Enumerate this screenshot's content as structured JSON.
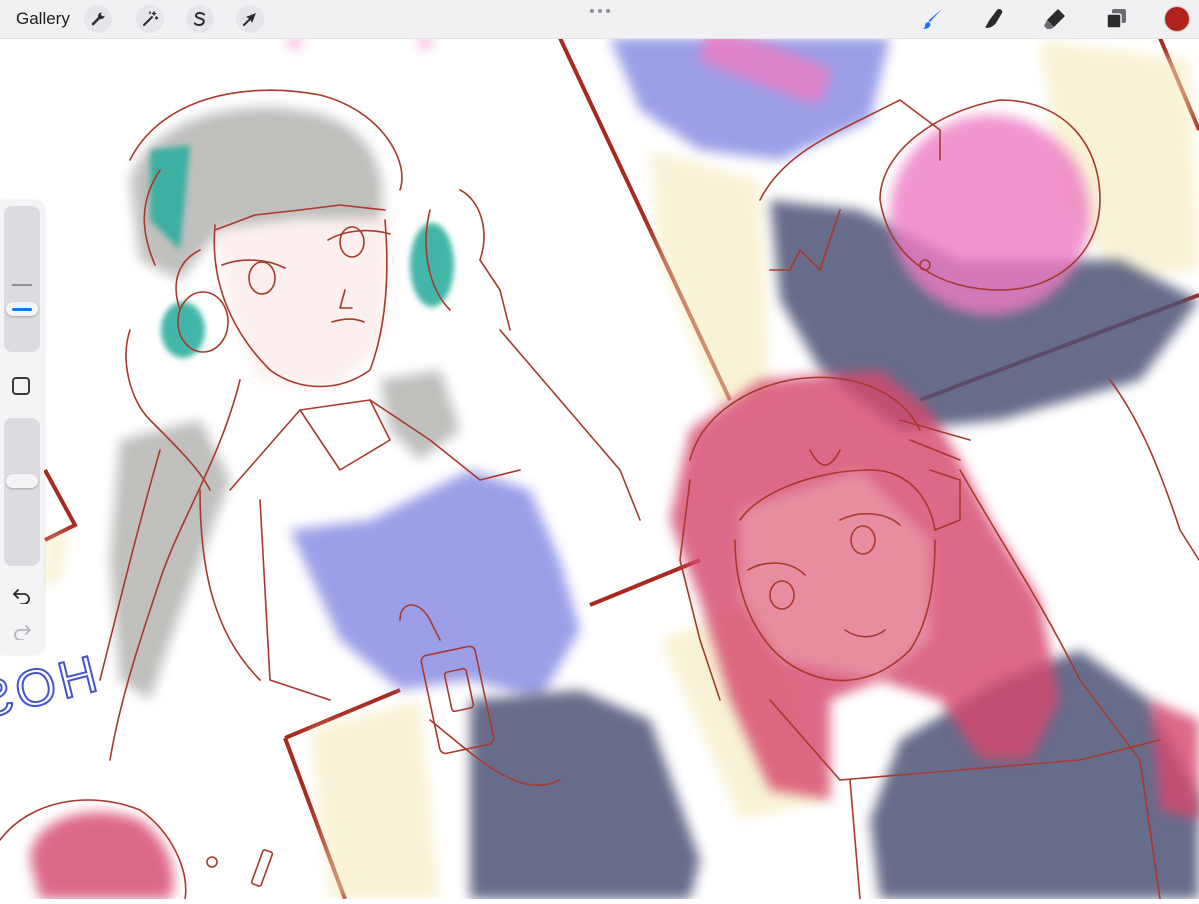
{
  "app": {
    "gallery_label": "Gallery",
    "accent_color": "#1c73e8",
    "current_color": "#b0231c"
  },
  "toolbar": {
    "left_tools": [
      {
        "name": "actions",
        "icon": "wrench-icon"
      },
      {
        "name": "adjustments",
        "icon": "magic-wand-icon"
      },
      {
        "name": "selection",
        "icon": "selection-s-icon"
      },
      {
        "name": "transform",
        "icon": "arrow-cursor-icon"
      }
    ],
    "right_tools": [
      {
        "name": "brush",
        "icon": "brush-icon",
        "active": true
      },
      {
        "name": "smudge",
        "icon": "smudge-finger-icon"
      },
      {
        "name": "eraser",
        "icon": "eraser-icon"
      },
      {
        "name": "layers",
        "icon": "layers-icon"
      }
    ]
  },
  "sidebar": {
    "brush_size": 0.65,
    "opacity": 0.45,
    "buttons": [
      {
        "name": "modify",
        "icon": "square-icon"
      },
      {
        "name": "undo",
        "icon": "undo-icon"
      },
      {
        "name": "redo",
        "icon": "redo-icon"
      }
    ]
  },
  "canvas": {
    "mirrored_text": "HOS"
  }
}
